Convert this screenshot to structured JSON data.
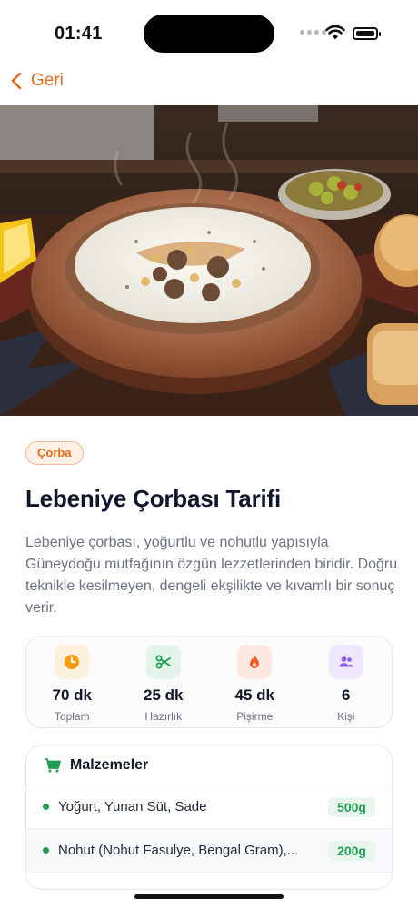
{
  "status_bar": {
    "time": "01:41"
  },
  "nav": {
    "back_label": "Geri"
  },
  "hero": {
    "image_alt": "Lebeniye Çorbası"
  },
  "recipe": {
    "category": "Çorba",
    "title": "Lebeniye Çorbası Tarifi",
    "description": "Lebeniye çorbası, yoğurtlu ve nohutlu yapısıyla Güneydoğu mutfağının özgün lezzetlerinden biridir. Doğru teknikle kesilmeyen, dengeli ekşilikte ve kıvamlı bir sonuç verir."
  },
  "stats": [
    {
      "icon": "clock-icon",
      "value": "70 dk",
      "label": "Toplam",
      "bg": "#fdf0dc",
      "color": "#f59e0b"
    },
    {
      "icon": "scissors-icon",
      "value": "25 dk",
      "label": "Hazırlık",
      "bg": "#e3f5ea",
      "color": "#16a34a"
    },
    {
      "icon": "flame-icon",
      "value": "45 dk",
      "label": "Pişirme",
      "bg": "#fde9e2",
      "color": "#ef5b25"
    },
    {
      "icon": "people-icon",
      "value": "6",
      "label": "Kişi",
      "bg": "#efe7fd",
      "color": "#8b5cf6"
    }
  ],
  "ingredients": {
    "title": "Malzemeler",
    "items": [
      {
        "name": "Yoğurt, Yunan Süt, Sade",
        "qty": "500g"
      },
      {
        "name": "Nohut (Nohut Fasulye, Bengal Gram),...",
        "qty": "200g"
      }
    ]
  },
  "colors": {
    "accent": "#e56a1c",
    "green": "#1f9d55"
  }
}
